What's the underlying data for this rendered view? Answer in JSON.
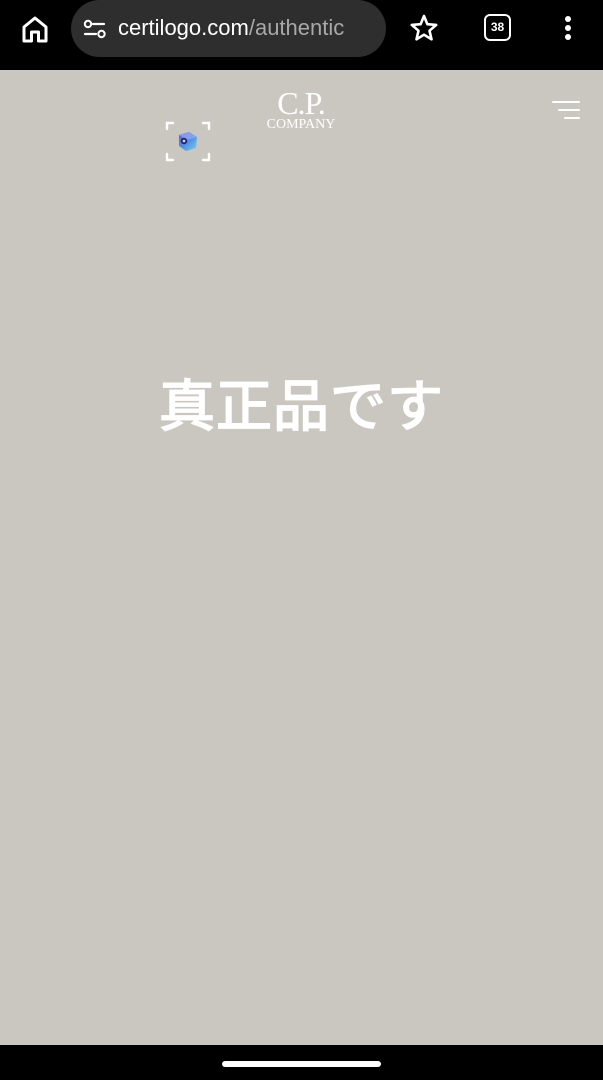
{
  "browser": {
    "url_host": "certilogo.com",
    "url_path": "/authentic",
    "tab_count": "38",
    "icons": {
      "home": "home-icon",
      "site_info": "tune-icon",
      "bookmark": "star-outline-icon",
      "tabs": "tab-switcher-icon",
      "menu": "more-vert-icon"
    }
  },
  "page": {
    "background_color": "#cac7c0",
    "logo": {
      "top": "C.P.",
      "bottom": "COMPANY"
    },
    "headline": "真正品です",
    "icons": {
      "nav_menu": "hamburger-menu-icon",
      "ar_scan": "ar-scan-cube-icon"
    }
  }
}
